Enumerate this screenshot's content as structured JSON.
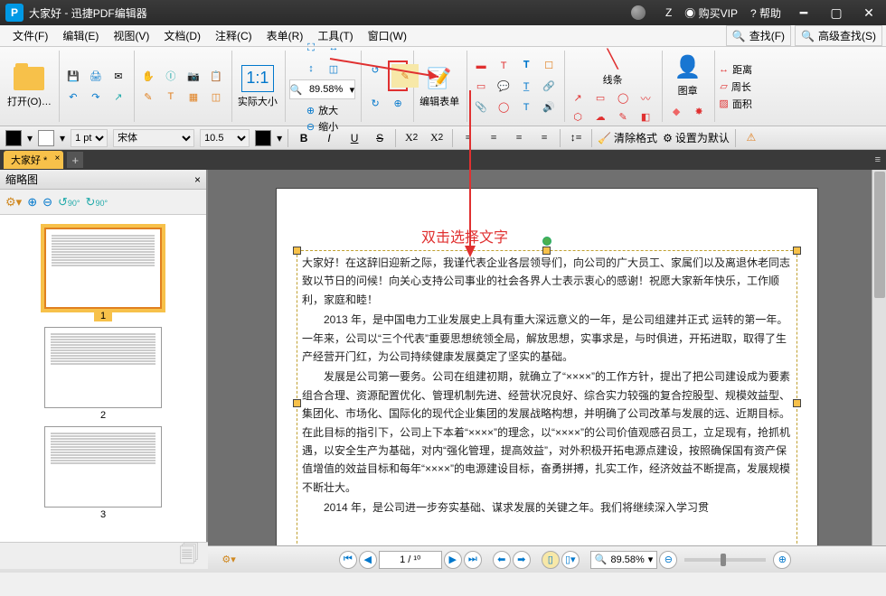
{
  "title": {
    "doc": "大家好",
    "app": "迅捷PDF编辑器"
  },
  "titlebar_right": {
    "user": "Z",
    "vip": "购买VIP",
    "help": "帮助"
  },
  "menubar": {
    "items": [
      "文件(F)",
      "编辑(E)",
      "视图(V)",
      "文档(D)",
      "注释(C)",
      "表单(R)",
      "工具(T)",
      "窗口(W)"
    ],
    "search": "查找(F)",
    "adv_search": "高级查找(S)"
  },
  "ribbon": {
    "open": "打开(O)…",
    "actual_size": "实际大小",
    "zoom_value": "89.58%",
    "zoom_in": "放大",
    "zoom_out": "缩小",
    "edit_form": "编辑表单",
    "line": "线条",
    "stamp": "图章",
    "distance": "距离",
    "perimeter": "周长",
    "area": "面积"
  },
  "fmtbar": {
    "stroke_w": "1 pt",
    "font": "宋体",
    "size": "10.5",
    "clear_fmt": "清除格式",
    "set_default": "设置为默认"
  },
  "tab": {
    "name": "大家好 *"
  },
  "thumbnails": {
    "title": "缩略图",
    "pages": [
      "1",
      "2",
      "3"
    ],
    "rot_a": "90°",
    "rot_b": "90°"
  },
  "annotation": {
    "hint": "双击选择文字"
  },
  "doc_body": {
    "p1": "大家好！在这辞旧迎新之际，我谨代表企业各层领导们，向公司的广大员工、家属们以及离退休老同志致以节日的问候！向关心支持公司事业的社会各界人士表示衷心的感谢！祝愿大家新年快乐，工作顺利，家庭和睦！",
    "p2": "2013 年，是中国电力工业发展史上具有重大深远意义的一年，是公司组建并正式 运转的第一年。一年来，公司以“三个代表”重要思想统领全局，解放思想，实事求是，与时俱进，开拓进取，取得了生产经营开门红，为公司持续健康发展奠定了坚实的基础。",
    "p3": "发展是公司第一要务。公司在组建初期，就确立了“××××”的工作方针，提出了把公司建设成为要素组合合理、资源配置优化、管理机制先进、经营状况良好、综合实力较强的复合控股型、规模效益型、集团化、市场化、国际化的现代企业集团的发展战略构想，并明确了公司改革与发展的远、近期目标。在此目标的指引下，公司上下本着“××××”的理念，以“××××”的公司价值观感召员工，立足现有，抢抓机遇，以安全生产为基础，对内“强化管理，提高效益”，对外积极开拓电源点建设，按照确保国有资产保值增值的效益目标和每年“××××”的电源建设目标，奋勇拼搏，扎实工作，经济效益不断提高，发展规模不断壮大。",
    "p4": "2014 年，是公司进一步夯实基础、谋求发展的关键之年。我们将继续深入学习贯"
  },
  "status": {
    "page_display": "1 / ¹⁰",
    "zoom": "89.58%"
  }
}
